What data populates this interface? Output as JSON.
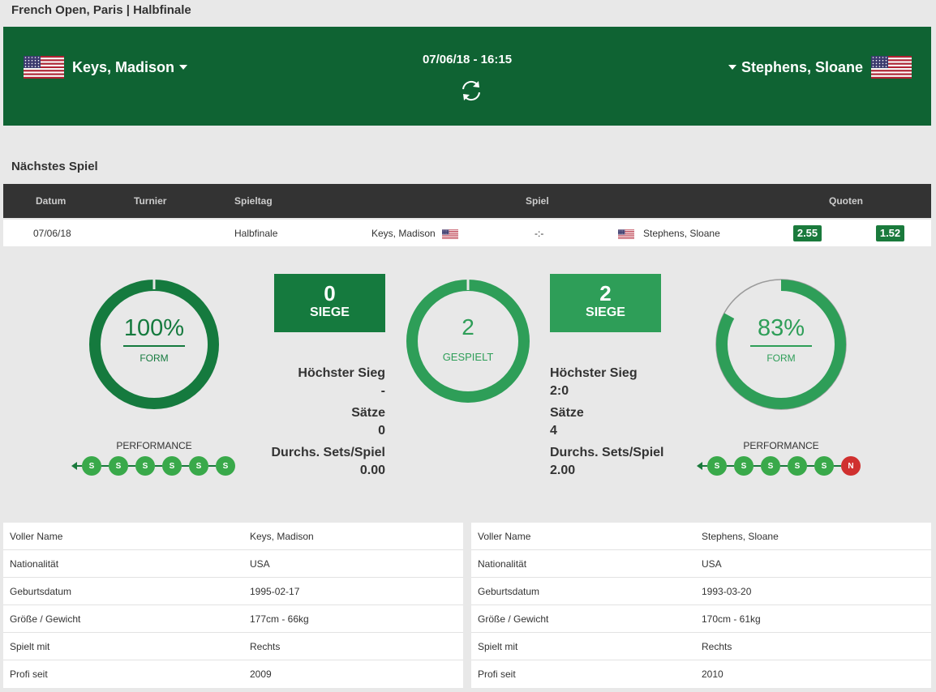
{
  "header": {
    "title": "French Open, Paris | Halbfinale"
  },
  "hero": {
    "home_name": "Keys, Madison",
    "away_name": "Stephens, Sloane",
    "datetime": "07/06/18 - 16:15"
  },
  "next_match": {
    "section_title": "Nächstes Spiel",
    "columns": {
      "date": "Datum",
      "tournament": "Turnier",
      "round": "Spieltag",
      "match": "Spiel",
      "odds": "Quoten"
    },
    "row": {
      "date": "07/06/18",
      "tournament": "",
      "round": "Halbfinale",
      "home": "Keys, Madison",
      "score": "-:-",
      "away": "Stephens, Sloane",
      "odds_home": "2.55",
      "odds_away": "1.52"
    }
  },
  "comparison": {
    "home_form": {
      "value": "100%",
      "label": "FORM",
      "fraction": 1.0
    },
    "away_form": {
      "value": "83%",
      "label": "FORM",
      "fraction": 0.83
    },
    "played": {
      "value": "2",
      "label": "GESPIELT",
      "fraction": 1.0
    },
    "home_wins": {
      "value": "0",
      "label": "SIEGE"
    },
    "away_wins": {
      "value": "2",
      "label": "SIEGE"
    },
    "home_stats": {
      "highest_win_label": "Höchster Sieg",
      "highest_win": "-",
      "sets_label": "Sätze",
      "sets": "0",
      "avg_label": "Durchs. Sets/Spiel",
      "avg": "0.00"
    },
    "away_stats": {
      "highest_win_label": "Höchster Sieg",
      "highest_win": "2:0",
      "sets_label": "Sätze",
      "sets": "4",
      "avg_label": "Durchs. Sets/Spiel",
      "avg": "2.00"
    },
    "performance_label": "PERFORMANCE",
    "home_performance": [
      "S",
      "S",
      "S",
      "S",
      "S",
      "S"
    ],
    "away_performance": [
      "S",
      "S",
      "S",
      "S",
      "S",
      "N"
    ]
  },
  "home_info": [
    {
      "key": "Voller Name",
      "value": "Keys, Madison"
    },
    {
      "key": "Nationalität",
      "value": "USA"
    },
    {
      "key": "Geburtsdatum",
      "value": "1995-02-17"
    },
    {
      "key": "Größe / Gewicht",
      "value": "177cm - 66kg"
    },
    {
      "key": "Spielt mit",
      "value": "Rechts"
    },
    {
      "key": "Profi seit",
      "value": "2009"
    }
  ],
  "away_info": [
    {
      "key": "Voller Name",
      "value": "Stephens, Sloane"
    },
    {
      "key": "Nationalität",
      "value": "USA"
    },
    {
      "key": "Geburtsdatum",
      "value": "1993-03-20"
    },
    {
      "key": "Größe / Gewicht",
      "value": "170cm - 61kg"
    },
    {
      "key": "Spielt mit",
      "value": "Rechts"
    },
    {
      "key": "Profi seit",
      "value": "2010"
    }
  ],
  "colors": {
    "hero_bg": "#0f6333",
    "dark_green": "#157a3e",
    "light_green": "#2e9e58",
    "win_dot": "#39a94a",
    "loss_dot": "#d0302f"
  },
  "icons": {
    "flag": "us-flag-icon",
    "refresh": "refresh-icon",
    "dropdown": "caret-down-icon"
  }
}
